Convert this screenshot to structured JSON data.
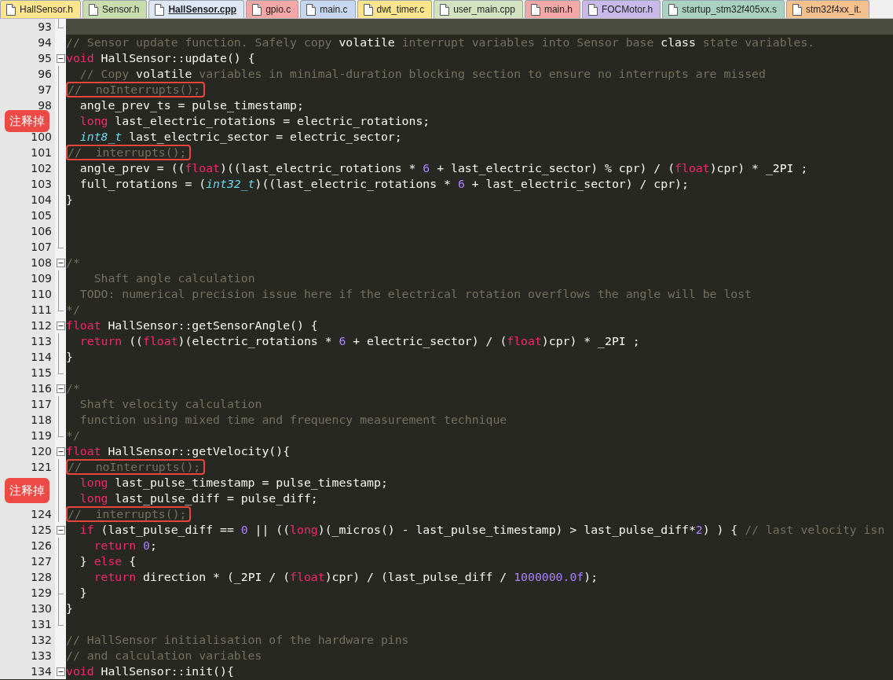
{
  "tabs": [
    {
      "label": "HallSensor.h",
      "selected": false,
      "color": "#fde58e"
    },
    {
      "label": "Sensor.h",
      "selected": false,
      "color": "#c9dcae"
    },
    {
      "label": "HallSensor.cpp",
      "selected": true,
      "color": "#dde7f6"
    },
    {
      "label": "gpio.c",
      "selected": false,
      "color": "#f3a7a7"
    },
    {
      "label": "main.c",
      "selected": false,
      "color": "#c8d7f1"
    },
    {
      "label": "dwt_timer.c",
      "selected": false,
      "color": "#fde58e"
    },
    {
      "label": "user_main.cpp",
      "selected": false,
      "color": "#d3e3bf"
    },
    {
      "label": "main.h",
      "selected": false,
      "color": "#f3a7a7"
    },
    {
      "label": "FOCMotor.h",
      "selected": false,
      "color": "#c7b9ea"
    },
    {
      "label": "startup_stm32f405xx.s",
      "selected": false,
      "color": "#a9d2c2"
    },
    {
      "label": "stm32f4xx_it.",
      "selected": false,
      "color": "#f7c18e"
    }
  ],
  "lines": [
    {
      "number": "93",
      "current": true,
      "kind": "end"
    },
    {
      "number": "94",
      "kind": "none",
      "tokens": [
        {
          "kind": "comment",
          "text": "// Sensor update function. Safely copy "
        },
        {
          "kind": "plain",
          "text": "volatile"
        },
        {
          "kind": "comment",
          "text": " interrupt variables into Sensor base "
        },
        {
          "kind": "plain",
          "text": "class"
        },
        {
          "kind": "comment",
          "text": " state variables."
        }
      ]
    },
    {
      "number": "95",
      "kind": "start",
      "tokens": [
        {
          "kind": "keyword",
          "text": "void"
        },
        {
          "kind": "plain",
          "text": " HallSensor::update() {"
        }
      ]
    },
    {
      "number": "96",
      "kind": "line",
      "tokens": [
        {
          "kind": "comment",
          "text": "  // Copy "
        },
        {
          "kind": "plain",
          "text": "volatile"
        },
        {
          "kind": "comment",
          "text": " variables in minimal-duration blocking section to ensure no interrupts are missed"
        }
      ]
    },
    {
      "number": "97",
      "kind": "line",
      "boxed": true,
      "tokens": [
        {
          "kind": "comment",
          "text": "//  noInterrupts();"
        }
      ]
    },
    {
      "number": "98",
      "kind": "line",
      "tokens": [
        {
          "kind": "plain",
          "text": "  angle_prev_ts = pulse_timestamp;"
        }
      ]
    },
    {
      "kind": "line",
      "callout": "注释掉",
      "tokens": [
        {
          "kind": "keyword",
          "text": "  long"
        },
        {
          "kind": "plain",
          "text": " last_electric_rotations = electric_rotations;"
        }
      ]
    },
    {
      "number": "100",
      "kind": "line",
      "tokens": [
        {
          "kind": "type",
          "text": "  int8_t"
        },
        {
          "kind": "plain",
          "text": " last_electric_sector = electric_sector;"
        }
      ]
    },
    {
      "number": "101",
      "kind": "line",
      "boxed": true,
      "tokens": [
        {
          "kind": "comment",
          "text": "//  interrupts();"
        }
      ]
    },
    {
      "number": "102",
      "kind": "line",
      "tokens": [
        {
          "kind": "plain",
          "text": "  angle_prev = (("
        },
        {
          "kind": "keyword",
          "text": "float"
        },
        {
          "kind": "plain",
          "text": ")((last_electric_rotations * "
        },
        {
          "kind": "number",
          "text": "6"
        },
        {
          "kind": "plain",
          "text": " + last_electric_sector) % cpr) / ("
        },
        {
          "kind": "keyword",
          "text": "float"
        },
        {
          "kind": "plain",
          "text": ")cpr) * _2PI ;"
        }
      ]
    },
    {
      "number": "103",
      "kind": "line",
      "tokens": [
        {
          "kind": "plain",
          "text": "  full_rotations = ("
        },
        {
          "kind": "type",
          "text": "int32_t"
        },
        {
          "kind": "plain",
          "text": ")((last_electric_rotations * "
        },
        {
          "kind": "number",
          "text": "6"
        },
        {
          "kind": "plain",
          "text": " + last_electric_sector) / cpr);"
        }
      ]
    },
    {
      "number": "104",
      "kind": "line",
      "tokens": [
        {
          "kind": "plain",
          "text": "}"
        }
      ]
    },
    {
      "number": "105",
      "kind": "line"
    },
    {
      "number": "106",
      "kind": "line"
    },
    {
      "number": "107",
      "kind": "end"
    },
    {
      "number": "108",
      "kind": "start",
      "tokens": [
        {
          "kind": "comment",
          "text": "/*"
        }
      ]
    },
    {
      "number": "109",
      "kind": "line",
      "tokens": [
        {
          "kind": "comment",
          "text": "\tShaft angle calculation"
        }
      ]
    },
    {
      "number": "110",
      "kind": "line",
      "tokens": [
        {
          "kind": "comment",
          "text": "  TODO: numerical precision issue here if the electrical rotation overflows the angle will be lost"
        }
      ]
    },
    {
      "number": "111",
      "kind": "end",
      "tokens": [
        {
          "kind": "comment",
          "text": "*/"
        }
      ]
    },
    {
      "number": "112",
      "kind": "start",
      "tokens": [
        {
          "kind": "keyword",
          "text": "float"
        },
        {
          "kind": "plain",
          "text": " HallSensor::getSensorAngle() {"
        }
      ]
    },
    {
      "number": "113",
      "kind": "line",
      "tokens": [
        {
          "kind": "keyword",
          "text": "  return"
        },
        {
          "kind": "plain",
          "text": " (("
        },
        {
          "kind": "keyword",
          "text": "float"
        },
        {
          "kind": "plain",
          "text": ")(electric_rotations * "
        },
        {
          "kind": "number",
          "text": "6"
        },
        {
          "kind": "plain",
          "text": " + electric_sector) / ("
        },
        {
          "kind": "keyword",
          "text": "float"
        },
        {
          "kind": "plain",
          "text": ")cpr) * _2PI ;"
        }
      ]
    },
    {
      "number": "114",
      "kind": "line",
      "tokens": [
        {
          "kind": "plain",
          "text": "}"
        }
      ]
    },
    {
      "number": "115",
      "kind": "end"
    },
    {
      "number": "116",
      "kind": "start",
      "tokens": [
        {
          "kind": "comment",
          "text": "/*"
        }
      ]
    },
    {
      "number": "117",
      "kind": "line",
      "tokens": [
        {
          "kind": "comment",
          "text": "  Shaft velocity calculation"
        }
      ]
    },
    {
      "number": "118",
      "kind": "line",
      "tokens": [
        {
          "kind": "comment",
          "text": "  function using mixed time and frequency measurement technique"
        }
      ]
    },
    {
      "number": "119",
      "kind": "end",
      "tokens": [
        {
          "kind": "comment",
          "text": "*/"
        }
      ]
    },
    {
      "number": "120",
      "kind": "start",
      "tokens": [
        {
          "kind": "keyword",
          "text": "float"
        },
        {
          "kind": "plain",
          "text": " HallSensor::getVelocity(){"
        }
      ]
    },
    {
      "number": "121",
      "kind": "line",
      "boxed": true,
      "tokens": [
        {
          "kind": "comment",
          "text": "//  noInterrupts();"
        }
      ]
    },
    {
      "kind": "line",
      "callout": "注释掉",
      "tokens": [
        {
          "kind": "keyword",
          "text": "  long"
        },
        {
          "kind": "plain",
          "text": " last_pulse_timestamp = pulse_timestamp;"
        }
      ]
    },
    {
      "kind": "line",
      "tokens": [
        {
          "kind": "keyword",
          "text": "  long"
        },
        {
          "kind": "plain",
          "text": " last_pulse_diff = pulse_diff;"
        }
      ]
    },
    {
      "number": "124",
      "kind": "line",
      "boxed": true,
      "tokens": [
        {
          "kind": "comment",
          "text": "//  interrupts();"
        }
      ]
    },
    {
      "number": "125",
      "kind": "start",
      "tokens": [
        {
          "kind": "keyword",
          "text": "  if"
        },
        {
          "kind": "plain",
          "text": " (last_pulse_diff == "
        },
        {
          "kind": "number",
          "text": "0"
        },
        {
          "kind": "plain",
          "text": " || (("
        },
        {
          "kind": "keyword",
          "text": "long"
        },
        {
          "kind": "plain",
          "text": ")(_micros() - last_pulse_timestamp) > last_pulse_diff*"
        },
        {
          "kind": "number",
          "text": "2"
        },
        {
          "kind": "plain",
          "text": ") ) { "
        },
        {
          "kind": "comment",
          "text": "// last velocity isn"
        }
      ]
    },
    {
      "number": "126",
      "kind": "line",
      "tokens": [
        {
          "kind": "keyword",
          "text": "    return"
        },
        {
          "kind": "number",
          "text": " 0"
        },
        {
          "kind": "plain",
          "text": ";"
        }
      ]
    },
    {
      "number": "127",
      "kind": "line",
      "tokens": [
        {
          "kind": "plain",
          "text": "  } "
        },
        {
          "kind": "keyword",
          "text": "else"
        },
        {
          "kind": "plain",
          "text": " {"
        }
      ]
    },
    {
      "number": "128",
      "kind": "line",
      "tokens": [
        {
          "kind": "keyword",
          "text": "    return"
        },
        {
          "kind": "plain",
          "text": " direction * (_2PI / ("
        },
        {
          "kind": "keyword",
          "text": "float"
        },
        {
          "kind": "plain",
          "text": ")cpr) / (last_pulse_diff / "
        },
        {
          "kind": "number",
          "text": "1000000.0f"
        },
        {
          "kind": "plain",
          "text": ");"
        }
      ]
    },
    {
      "number": "129",
      "kind": "tee",
      "tokens": [
        {
          "kind": "plain",
          "text": "  }"
        }
      ]
    },
    {
      "number": "130",
      "kind": "line",
      "tokens": [
        {
          "kind": "plain",
          "text": "}"
        }
      ]
    },
    {
      "number": "131",
      "kind": "end"
    },
    {
      "number": "132",
      "kind": "none",
      "tokens": [
        {
          "kind": "comment",
          "text": "// HallSensor initialisation of the hardware pins"
        }
      ]
    },
    {
      "number": "133",
      "kind": "none",
      "tokens": [
        {
          "kind": "comment",
          "text": "// and calculation variables"
        }
      ]
    },
    {
      "number": "134",
      "kind": "start",
      "tokens": [
        {
          "kind": "keyword",
          "text": "void"
        },
        {
          "kind": "plain",
          "text": " HallSensor::init(){"
        }
      ]
    }
  ]
}
